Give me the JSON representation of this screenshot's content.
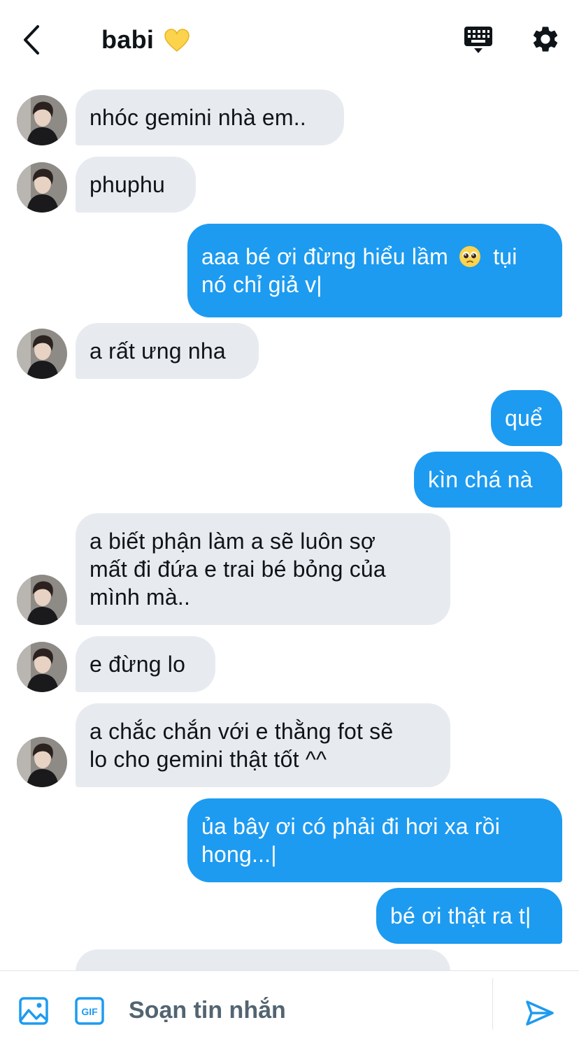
{
  "header": {
    "title": "babi",
    "title_emoji": "yellow-heart-icon"
  },
  "messages": [
    {
      "side": "in",
      "lines": [
        "nhóc gemini nhà em.."
      ]
    },
    {
      "side": "in",
      "lines": [
        "phuphu"
      ]
    },
    {
      "side": "out",
      "lines": [
        "aaa bé ơi đừng hiểu lầm",
        "tụi",
        "nó chỉ giả v|"
      ]
    },
    {
      "side": "in",
      "lines": [
        "a rất ưng nha"
      ]
    },
    {
      "side": "out",
      "lines": [
        "quể"
      ]
    },
    {
      "side": "out",
      "lines": [
        "kìn chá nà"
      ]
    },
    {
      "side": "in",
      "lines": [
        "a biết phận làm a sẽ luôn sợ",
        "mất đi đứa e trai bé bỏng của",
        "mình mà.."
      ]
    },
    {
      "side": "in",
      "lines": [
        "e đừng lo"
      ]
    },
    {
      "side": "in",
      "lines": [
        "a chắc chắn với e thằng fot sẽ",
        "lo cho gemini thật tốt ^^"
      ]
    },
    {
      "side": "out",
      "lines": [
        "ủa bây ơi có phải đi hơi xa rồi",
        "hong...|"
      ]
    },
    {
      "side": "out",
      "lines": [
        "bé ơi thật ra t|"
      ]
    }
  ],
  "composer": {
    "placeholder": "Soạn tin nhắn"
  },
  "colors": {
    "accent": "#1d9bf0",
    "incoming_bubble": "#e7ebef",
    "text": "#0f1419"
  }
}
